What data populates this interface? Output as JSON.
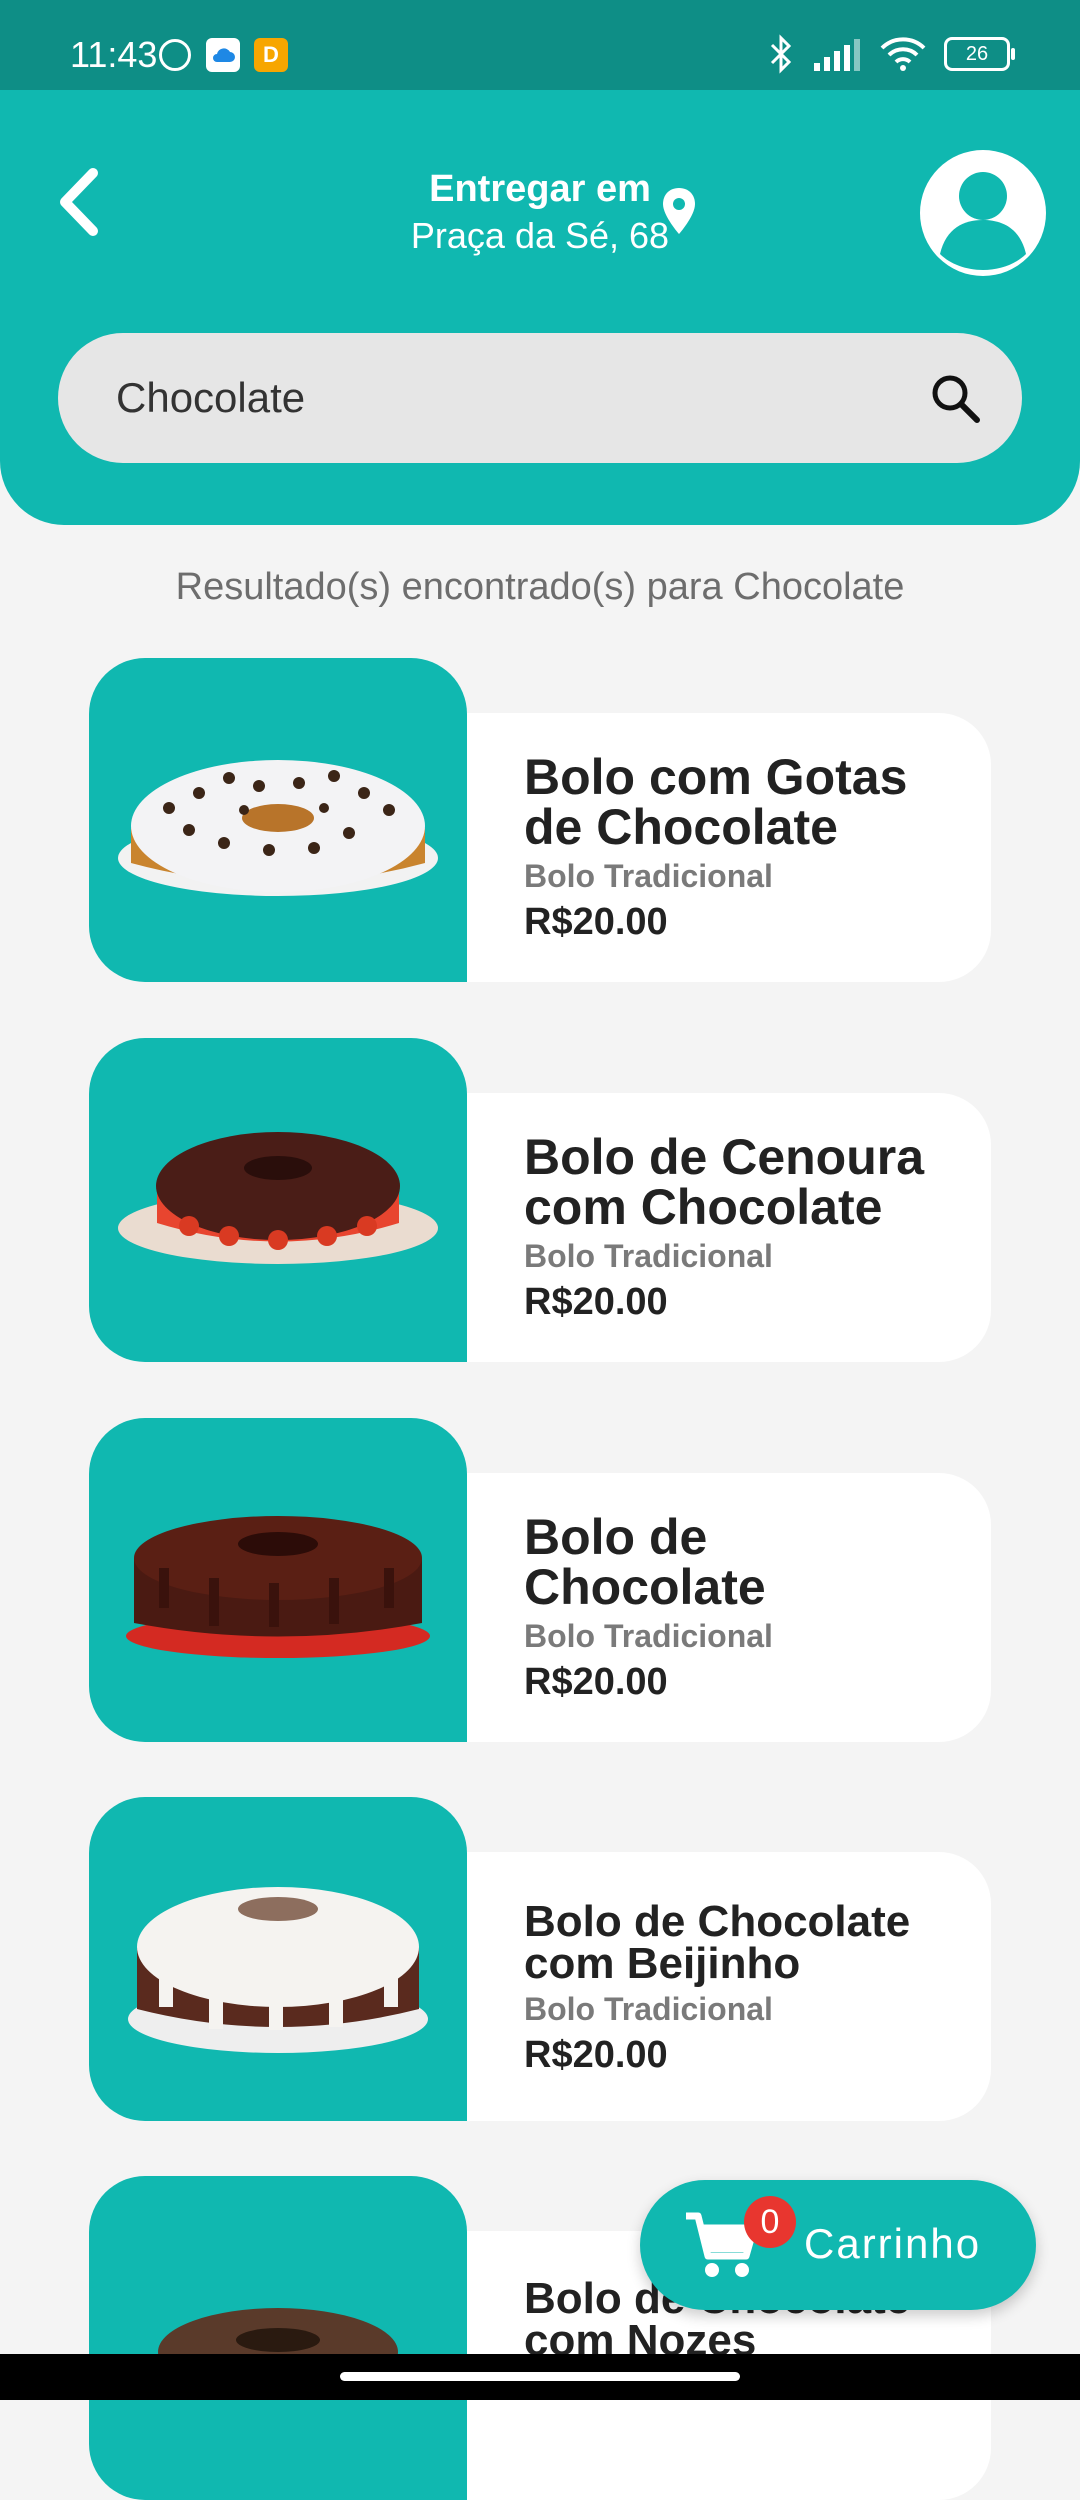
{
  "status": {
    "time": "11:43",
    "battery": "26",
    "icons": [
      "alarm-icon",
      "cloud-icon",
      "app-icon",
      "bluetooth-icon",
      "signal-icon",
      "wifi-icon",
      "battery-icon"
    ]
  },
  "header": {
    "deliver_title": "Entregar em",
    "address": "Praça da Sé, 68"
  },
  "search": {
    "value": "Chocolate"
  },
  "results_label": "Resultado(s) encontrado(s) para Chocolate",
  "products": [
    {
      "name": "Bolo com Gotas de Chocolate",
      "category": "Bolo Tradicional",
      "price": "R$20.00"
    },
    {
      "name": "Bolo de Cenoura com Chocolate",
      "category": "Bolo Tradicional",
      "price": "R$20.00"
    },
    {
      "name": "Bolo de Chocolate",
      "category": "Bolo Tradicional",
      "price": "R$20.00"
    },
    {
      "name": "Bolo de Chocolate com Beijinho",
      "category": "Bolo Tradicional",
      "price": "R$20.00"
    },
    {
      "name": "Bolo de Chocolate com Nozes",
      "category": "",
      "price": ""
    }
  ],
  "cart": {
    "count": "0",
    "label": "Carrinho"
  },
  "colors": {
    "primary": "#10b8b0",
    "status_bar": "#0e8e86",
    "badge": "#e8362f",
    "background": "#f4f4f4"
  }
}
